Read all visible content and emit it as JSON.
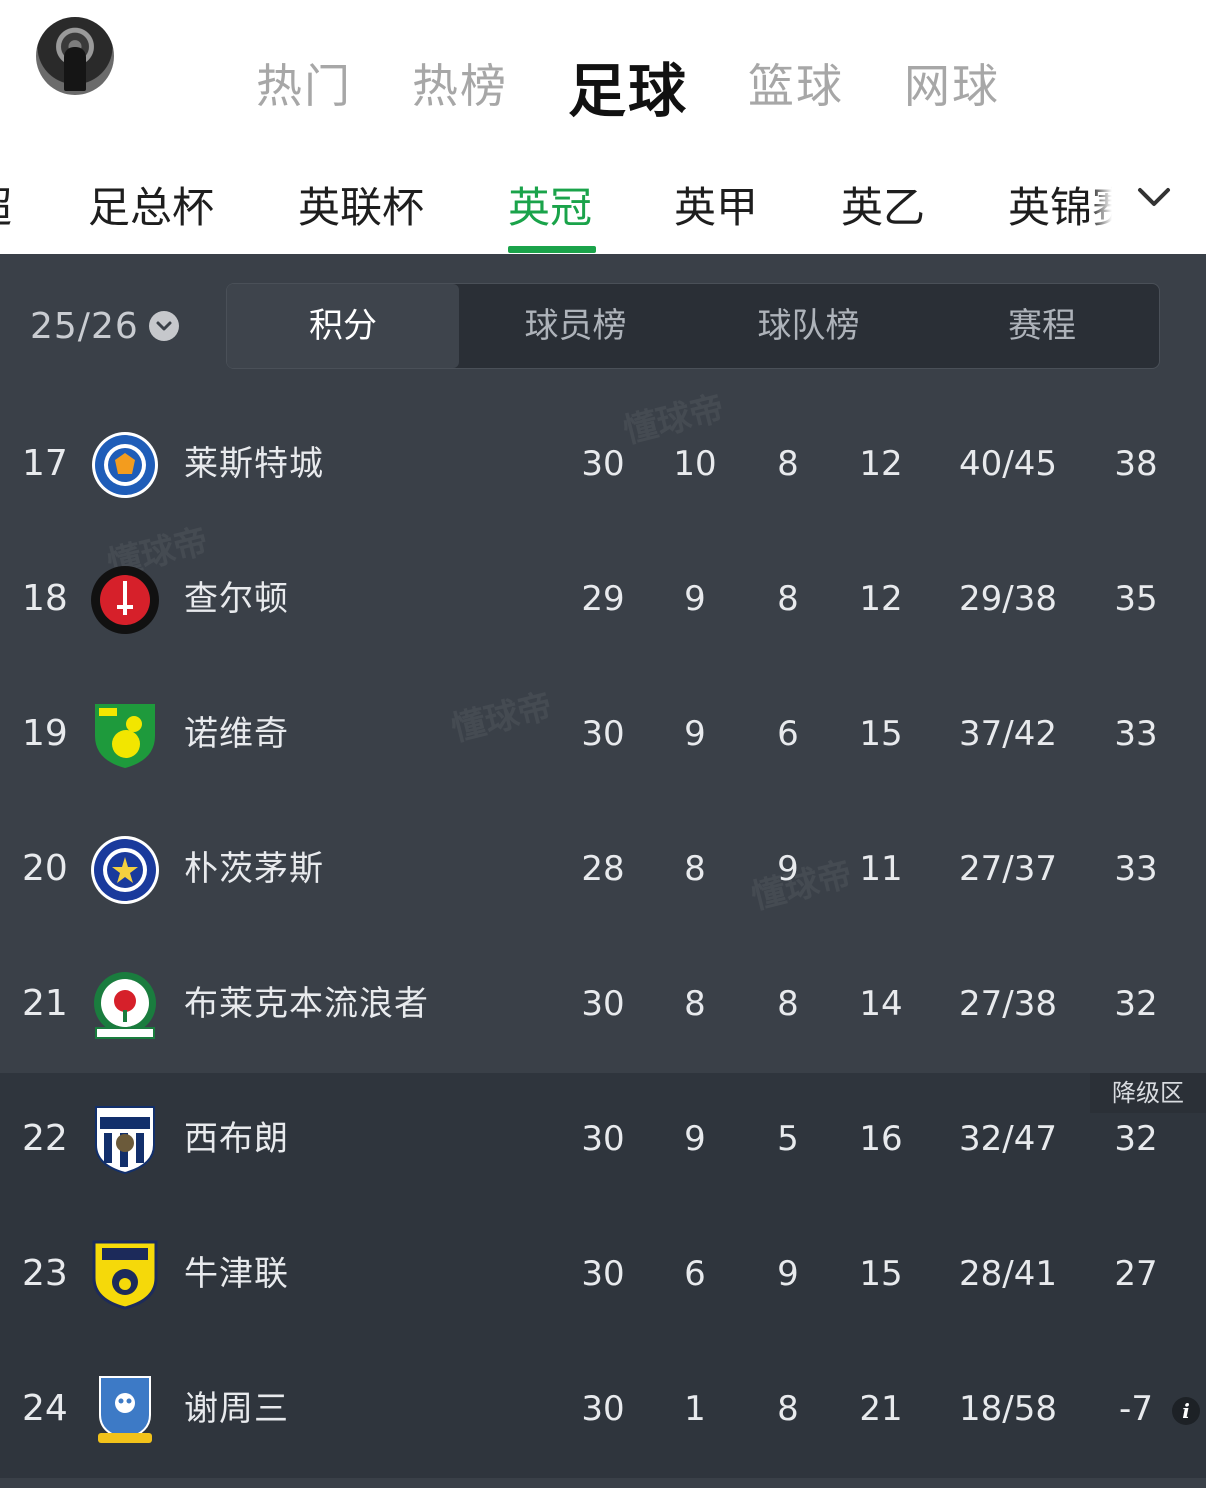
{
  "header": {
    "tabs": [
      {
        "label": "热门",
        "active": false
      },
      {
        "label": "热榜",
        "active": false
      },
      {
        "label": "足球",
        "active": true
      },
      {
        "label": "篮球",
        "active": false
      },
      {
        "label": "网球",
        "active": false
      }
    ]
  },
  "leagues": {
    "items": [
      {
        "label": "超",
        "active": false
      },
      {
        "label": "足总杯",
        "active": false
      },
      {
        "label": "英联杯",
        "active": false
      },
      {
        "label": "英冠",
        "active": true
      },
      {
        "label": "英甲",
        "active": false
      },
      {
        "label": "英乙",
        "active": false
      },
      {
        "label": "英锦赛",
        "active": false
      }
    ],
    "accent_color": "#1aa34a"
  },
  "toolbar": {
    "season": "25/26",
    "segments": [
      {
        "label": "积分",
        "active": true
      },
      {
        "label": "球员榜",
        "active": false
      },
      {
        "label": "球队榜",
        "active": false
      },
      {
        "label": "赛程",
        "active": false
      }
    ]
  },
  "standings": {
    "rows": [
      {
        "rank": "17",
        "team": "莱斯特城",
        "played": "30",
        "won": "10",
        "drawn": "8",
        "lost": "12",
        "goals": "40/45",
        "points": "38",
        "logo": "leicester-crest"
      },
      {
        "rank": "18",
        "team": "查尔顿",
        "played": "29",
        "won": "9",
        "drawn": "8",
        "lost": "12",
        "goals": "29/38",
        "points": "35",
        "logo": "charlton-crest"
      },
      {
        "rank": "19",
        "team": "诺维奇",
        "played": "30",
        "won": "9",
        "drawn": "6",
        "lost": "15",
        "goals": "37/42",
        "points": "33",
        "logo": "norwich-crest"
      },
      {
        "rank": "20",
        "team": "朴茨茅斯",
        "played": "28",
        "won": "8",
        "drawn": "9",
        "lost": "11",
        "goals": "27/37",
        "points": "33",
        "logo": "portsmouth-crest"
      },
      {
        "rank": "21",
        "team": "布莱克本流浪者",
        "played": "30",
        "won": "8",
        "drawn": "8",
        "lost": "14",
        "goals": "27/38",
        "points": "32",
        "logo": "blackburn-crest"
      },
      {
        "rank": "22",
        "team": "西布朗",
        "played": "30",
        "won": "9",
        "drawn": "5",
        "lost": "16",
        "goals": "32/47",
        "points": "32",
        "logo": "westbrom-crest"
      },
      {
        "rank": "23",
        "team": "牛津联",
        "played": "30",
        "won": "6",
        "drawn": "9",
        "lost": "15",
        "goals": "28/41",
        "points": "27",
        "logo": "oxford-crest"
      },
      {
        "rank": "24",
        "team": "谢周三",
        "played": "30",
        "won": "1",
        "drawn": "8",
        "lost": "21",
        "goals": "18/58",
        "points": "-7",
        "logo": "sheffield-wednesday-crest"
      }
    ],
    "relegation_label": "降级区",
    "info_icon": "i",
    "watermark": "懂球帝"
  }
}
